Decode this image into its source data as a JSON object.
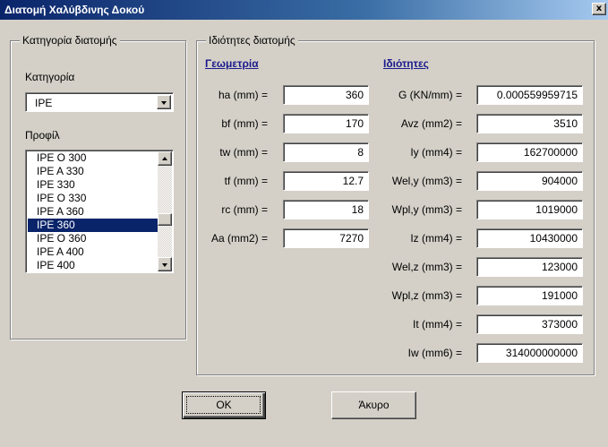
{
  "window": {
    "title": "Διατομή Χαλύβδινης Δοκού",
    "close_label": "x"
  },
  "category_frame": {
    "legend": "Κατηγορία διατομής",
    "category_label": "Κατηγορία",
    "category_value": "IPE",
    "profile_label": "Προφίλ",
    "profiles": [
      "IPE O 300",
      "IPE A 330",
      "IPE 330",
      "IPE O 330",
      "IPE A 360",
      "IPE 360",
      "IPE O 360",
      "IPE A 400",
      "IPE 400"
    ],
    "selected_profile": "IPE 360"
  },
  "properties_frame": {
    "legend": "Ιδιότητες διατομής",
    "geometry_heading": "Γεωμετρία",
    "properties_heading": "Ιδιότητες",
    "geometry": [
      {
        "label": "ha (mm) =",
        "value": "360"
      },
      {
        "label": "bf (mm) =",
        "value": "170"
      },
      {
        "label": "tw (mm) =",
        "value": "8"
      },
      {
        "label": "tf (mm) =",
        "value": "12.7"
      },
      {
        "label": "rc (mm) =",
        "value": "18"
      },
      {
        "label": "Aa (mm2) =",
        "value": "7270"
      }
    ],
    "properties": [
      {
        "label": "G (KN/mm) =",
        "value": "0.000559959715"
      },
      {
        "label": "Avz (mm2) =",
        "value": "3510"
      },
      {
        "label": "Iy (mm4) =",
        "value": "162700000"
      },
      {
        "label": "Wel,y (mm3) =",
        "value": "904000"
      },
      {
        "label": "Wpl,y (mm3) =",
        "value": "1019000"
      },
      {
        "label": "Iz (mm4) =",
        "value": "10430000"
      },
      {
        "label": "Wel,z (mm3) =",
        "value": "123000"
      },
      {
        "label": "Wpl,z (mm3) =",
        "value": "191000"
      },
      {
        "label": "It (mm4) =",
        "value": "373000"
      },
      {
        "label": "Iw (mm6) =",
        "value": "314000000000"
      }
    ]
  },
  "buttons": {
    "ok_label": "OK",
    "cancel_label": "Άκυρο"
  }
}
